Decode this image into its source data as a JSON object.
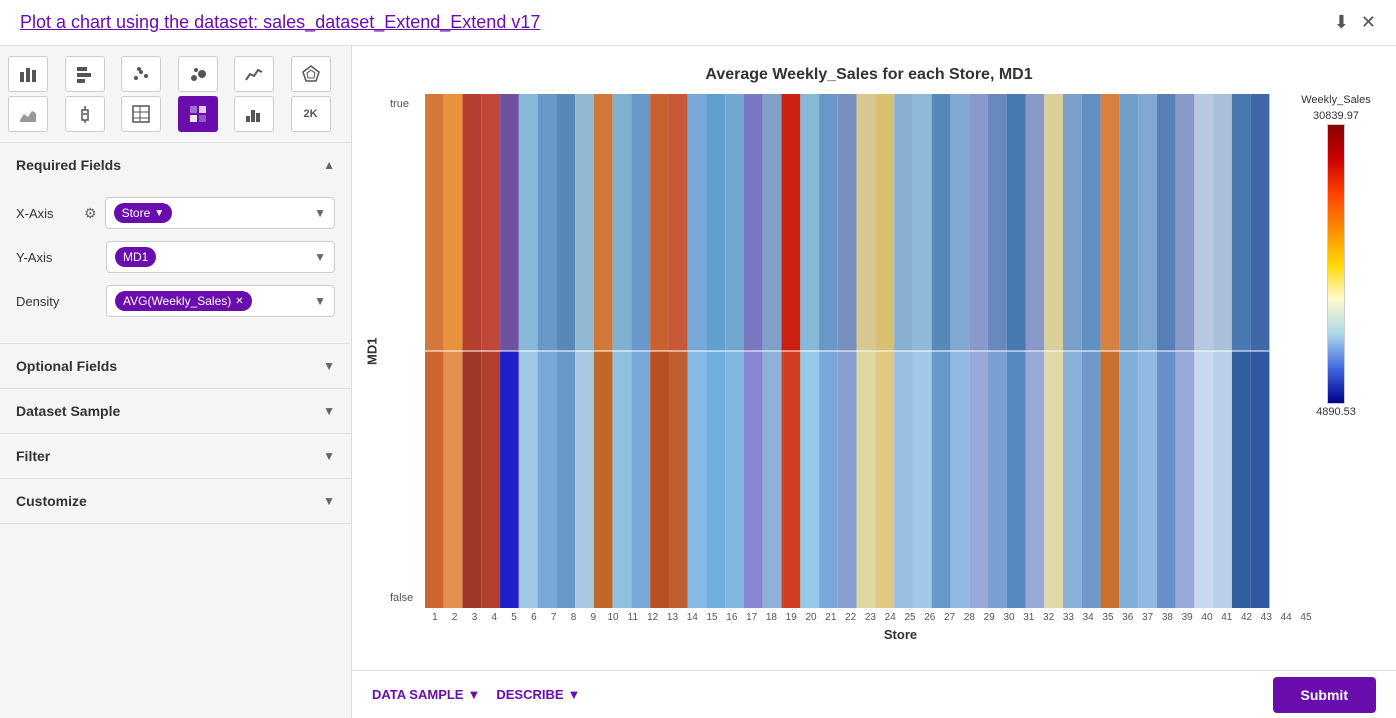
{
  "title": {
    "prefix": "Plot a chart using the dataset: ",
    "dataset": "sales_dataset_Extend_Extend v17"
  },
  "chartIcons": [
    {
      "id": "bar-vertical",
      "symbol": "▐▌",
      "active": false
    },
    {
      "id": "bar-horizontal",
      "symbol": "≡",
      "active": false
    },
    {
      "id": "scatter",
      "symbol": "⠿",
      "active": false
    },
    {
      "id": "bubble",
      "symbol": "⊙",
      "active": false
    },
    {
      "id": "line",
      "symbol": "∿",
      "active": false
    },
    {
      "id": "radar",
      "symbol": "◎",
      "active": false
    },
    {
      "id": "area",
      "symbol": "⌇",
      "active": false
    },
    {
      "id": "box",
      "symbol": "⊡",
      "active": false
    },
    {
      "id": "table",
      "symbol": "⊞",
      "active": false
    },
    {
      "id": "heatmap",
      "symbol": "⊟",
      "active": true
    },
    {
      "id": "histogram",
      "symbol": "⌐",
      "active": false
    },
    {
      "id": "twok",
      "symbol": "2K",
      "active": false
    }
  ],
  "sections": {
    "required": {
      "label": "Required Fields",
      "expanded": true,
      "fields": {
        "xAxis": {
          "label": "X-Axis",
          "value": "Store",
          "showGear": true
        },
        "yAxis": {
          "label": "Y-Axis",
          "value": "MD1",
          "showGear": false
        },
        "density": {
          "label": "Density",
          "value": "AVG(Weekly_Sales)",
          "showGear": false
        }
      }
    },
    "optional": {
      "label": "Optional Fields",
      "expanded": false
    },
    "datasetSample": {
      "label": "Dataset Sample",
      "expanded": false
    },
    "filter": {
      "label": "Filter",
      "expanded": false
    },
    "customize": {
      "label": "Customize",
      "expanded": false
    }
  },
  "chart": {
    "title": "Average Weekly_Sales for each Store, MD1",
    "xAxisLabel": "Store",
    "yAxisLabel": "MD1",
    "yTickTop": "true",
    "yTickBottom": "false",
    "legend": {
      "title": "Weekly_Sales",
      "max": "30839.97",
      "min": "4890.53"
    },
    "xTicks": [
      "1",
      "2",
      "3",
      "4",
      "5",
      "6",
      "7",
      "8",
      "9",
      "10",
      "11",
      "12",
      "13",
      "14",
      "15",
      "16",
      "17",
      "18",
      "19",
      "20",
      "21",
      "22",
      "23",
      "24",
      "25",
      "26",
      "27",
      "28",
      "29",
      "30",
      "31",
      "32",
      "33",
      "34",
      "35",
      "36",
      "37",
      "38",
      "39",
      "40",
      "41",
      "42",
      "43",
      "44",
      "45"
    ]
  },
  "bottomBar": {
    "dataSampleBtn": "DATA SAMPLE",
    "describeBtn": "DESCRIBE",
    "submitBtn": "Submit"
  }
}
